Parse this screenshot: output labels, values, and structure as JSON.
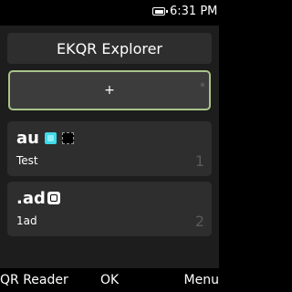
{
  "status_bar": {
    "time": "6:31 PM",
    "battery_icon": "battery-full-icon"
  },
  "header": {
    "title": "EKQR Explorer"
  },
  "add_row": {
    "plus_label": "+",
    "star_label": "*"
  },
  "entries": [
    {
      "name": "au",
      "subtitle": "Test",
      "number": "1",
      "icons": [
        "cyan-square-icon",
        "qr-code-icon"
      ],
      "accent": "#3fd9e9"
    },
    {
      "name": ".ad",
      "subtitle": "1ad",
      "number": "2",
      "icons": [
        "white-square-icon"
      ]
    }
  ],
  "softkeys": {
    "left": "QR Reader",
    "center": "OK",
    "right": "Menu"
  },
  "colors": {
    "background": "#1d1d1d",
    "card": "#2e2e2e",
    "focus_border": "#a9c48a"
  }
}
